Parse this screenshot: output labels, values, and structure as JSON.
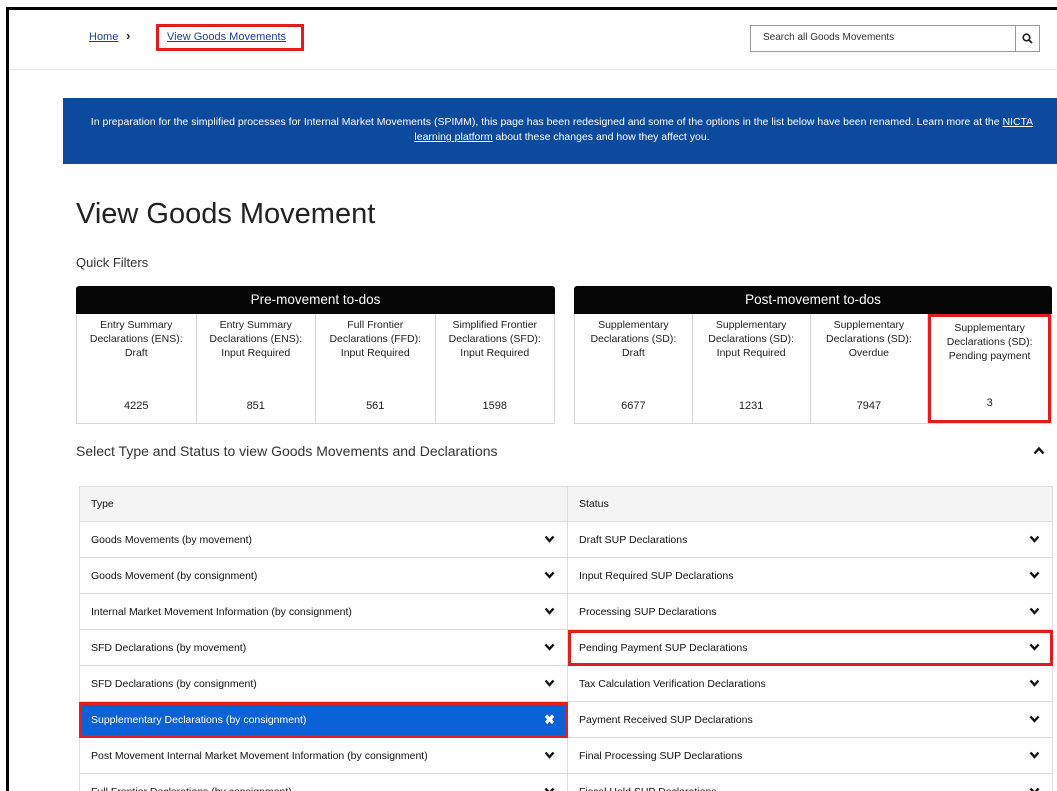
{
  "breadcrumb": {
    "home": "Home",
    "separator": "›",
    "current": "View Goods Movements"
  },
  "search": {
    "placeholder": "Search all Goods Movements"
  },
  "banner": {
    "text_before": "In preparation for the simplified processes for Internal Market Movements (SPIMM), this page has been redesigned and some of the options in the list below have been renamed. Learn more at the ",
    "link": "NICTA learning platform",
    "text_after": " about these changes and how they affect you."
  },
  "page": {
    "title": "View Goods Movement",
    "quick_filters": "Quick Filters"
  },
  "pre_movement": {
    "title": "Pre-movement to-dos",
    "cells": [
      {
        "label": "Entry Summary Declarations (ENS): Draft",
        "count": "4225"
      },
      {
        "label": "Entry Summary Declarations (ENS): Input Required",
        "count": "851"
      },
      {
        "label": "Full Frontier Declarations (FFD): Input Required",
        "count": "561"
      },
      {
        "label": "Simplified Frontier Declarations (SFD): Input Required",
        "count": "1598"
      }
    ]
  },
  "post_movement": {
    "title": "Post-movement to-dos",
    "cells": [
      {
        "label": "Supplementary Declarations (SD): Draft",
        "count": "6677"
      },
      {
        "label": "Supplementary Declarations (SD): Input Required",
        "count": "1231"
      },
      {
        "label": "Supplementary Declarations (SD): Overdue",
        "count": "7947"
      },
      {
        "label": "Supplementary Declarations (SD): Pending payment",
        "count": "3"
      }
    ]
  },
  "selector": {
    "heading": "Select Type and Status to view Goods Movements and Declarations",
    "type_header": "Type",
    "status_header": "Status",
    "types": [
      "Goods Movements (by movement)",
      "Goods Movement (by consignment)",
      "Internal Market Movement Information (by consignment)",
      "SFD Declarations (by movement)",
      "SFD Declarations (by consignment)",
      "Supplementary Declarations (by consignment)",
      "Post Movement Internal Market Movement Information (by consignment)",
      "Full Frontier Declarations (by consignment)"
    ],
    "statuses": [
      "Draft SUP Declarations",
      "Input Required SUP Declarations",
      "Processing SUP Declarations",
      "Pending Payment SUP Declarations",
      "Tax Calculation Verification Declarations",
      "Payment Received SUP Declarations",
      "Final Processing SUP Declarations",
      "Fiscal Hold SUP Declarations"
    ]
  },
  "colors": {
    "banner": "#0c4a9e",
    "selected": "#0b61d6",
    "highlight": "#e21d1d"
  }
}
